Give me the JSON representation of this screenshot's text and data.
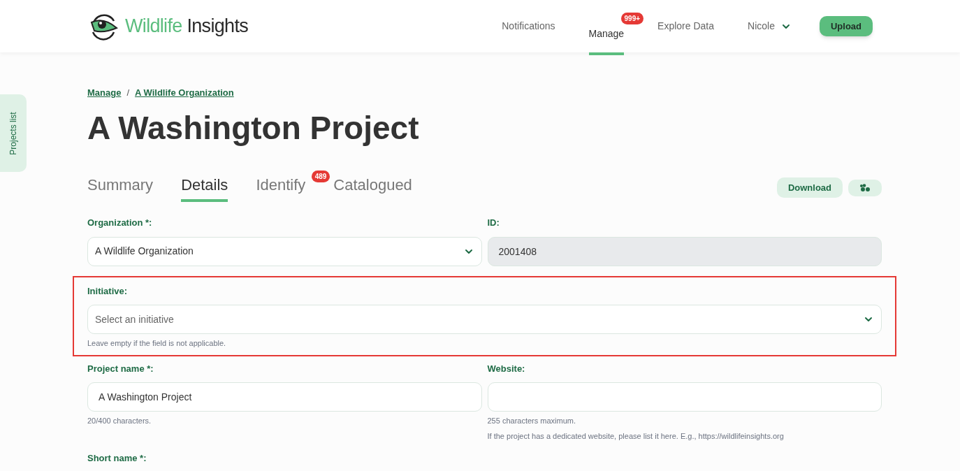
{
  "logo": {
    "part_1": "Wildlife",
    "part_2": "Insights"
  },
  "nav": [
    {
      "label": "Notifications",
      "selected": false
    },
    {
      "label": "Manage",
      "selected": true,
      "badge": "999+"
    },
    {
      "label": "Explore Data",
      "selected": false
    }
  ],
  "user": {
    "name": "Nicole"
  },
  "upload_button": "Upload",
  "side_tab": "Projects list",
  "breadcrumb": [
    "Manage",
    "A Wildlife Organization"
  ],
  "breadcrumb_separator": "/",
  "title": "A Washington Project",
  "tabs": [
    {
      "label": "Summary",
      "selected": false
    },
    {
      "label": "Details",
      "selected": true
    },
    {
      "label": "Identify",
      "selected": false,
      "badge": "489"
    },
    {
      "label": "Catalogued",
      "selected": false
    }
  ],
  "download_button": "Download",
  "rows": [
    {
      "fields": [
        {
          "kind": "select",
          "label": "Organization *:",
          "value": "A Wildlife Organization",
          "disabled": false
        },
        {
          "kind": "input",
          "label": "ID:",
          "value": "2001408",
          "disabled": true
        }
      ]
    },
    {
      "fields": [
        {
          "kind": "select",
          "label": "Initiative:",
          "placeholder": "Select an initiative",
          "disabled": false,
          "hints": [
            "Leave empty if the field is not applicable."
          ]
        }
      ],
      "highlighted": true
    },
    {
      "fields": [
        {
          "kind": "input",
          "label": "Project name *:",
          "value": "A Washington Project",
          "disabled": false,
          "hints": [
            "20/400 characters."
          ]
        },
        {
          "kind": "input",
          "label": "Website:",
          "disabled": false,
          "hints": [
            "255 characters maximum.",
            "If the project has a dedicated website, please list it here. E.g., https://wildlifeinsights.org"
          ]
        }
      ]
    },
    {
      "fields": [
        {
          "kind": "input",
          "label": "Short name *:"
        }
      ]
    }
  ]
}
